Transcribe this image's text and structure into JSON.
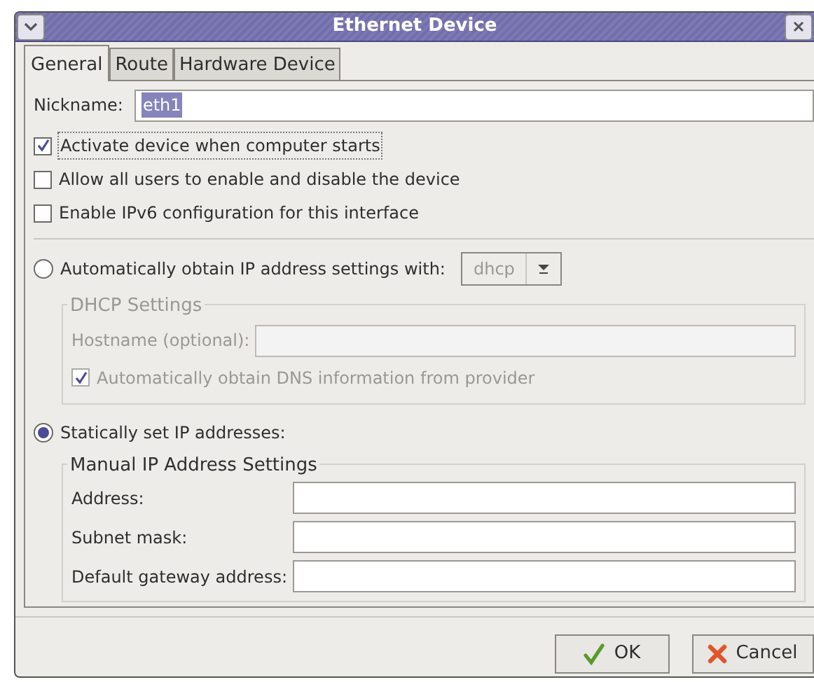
{
  "window": {
    "title": "Ethernet Device"
  },
  "tabs": [
    {
      "label": "General",
      "selected": true
    },
    {
      "label": "Route",
      "selected": false
    },
    {
      "label": "Hardware Device",
      "selected": false
    }
  ],
  "nickname": {
    "label": "Nickname:",
    "value": "eth1"
  },
  "options": [
    {
      "label": "Activate device when computer starts",
      "checked": true
    },
    {
      "label": "Allow all users to enable and disable the device",
      "checked": false
    },
    {
      "label": "Enable IPv6 configuration for this interface",
      "checked": false
    }
  ],
  "auto_ip": {
    "label": "Automatically obtain IP address settings with:",
    "selected": false,
    "method": "dhcp"
  },
  "dhcp_settings": {
    "title": "DHCP Settings",
    "disabled": true,
    "hostname_label": "Hostname (optional):",
    "dns_label": "Automatically obtain DNS information from provider",
    "dns_checked": true
  },
  "static_ip": {
    "label": "Statically set IP addresses:",
    "selected": true
  },
  "manual_settings": {
    "title": "Manual IP Address Settings",
    "fields": [
      {
        "label": "Address:"
      },
      {
        "label": "Subnet mask:"
      },
      {
        "label": "Default gateway address:"
      }
    ]
  },
  "buttons": [
    {
      "label": "OK",
      "kind": "ok"
    },
    {
      "label": "Cancel",
      "kind": "cancel"
    }
  ]
}
